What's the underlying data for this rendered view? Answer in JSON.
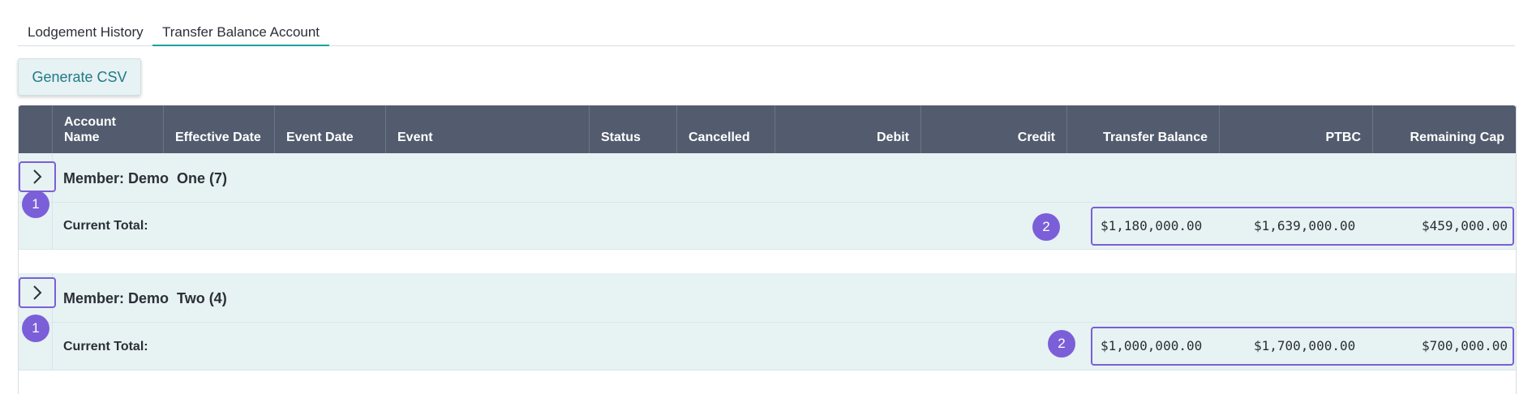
{
  "tabs": [
    {
      "label": "Lodgement History",
      "active": false
    },
    {
      "label": "Transfer Balance Account",
      "active": true
    }
  ],
  "actions": {
    "generate_csv_label": "Generate CSV"
  },
  "table": {
    "columns": [
      {
        "label": "",
        "align": "left"
      },
      {
        "label": "Account\nName",
        "align": "left"
      },
      {
        "label": "Effective Date",
        "align": "left"
      },
      {
        "label": "Event Date",
        "align": "left"
      },
      {
        "label": "Event",
        "align": "left"
      },
      {
        "label": "Status",
        "align": "left"
      },
      {
        "label": "Cancelled",
        "align": "left"
      },
      {
        "label": "Debit",
        "align": "right"
      },
      {
        "label": "Credit",
        "align": "right"
      },
      {
        "label": "Transfer Balance",
        "align": "right"
      },
      {
        "label": "PTBC",
        "align": "right"
      },
      {
        "label": "Remaining Cap",
        "align": "right"
      }
    ],
    "groups": [
      {
        "member_label": "Member: Demo",
        "member_name": "One (7)",
        "expand_badge": "1",
        "total_label": "Current Total:",
        "total_badge": "2",
        "transfer_balance": "$1,180,000.00",
        "ptbc": "$1,639,000.00",
        "remaining_cap": "$459,000.00"
      },
      {
        "member_label": "Member: Demo",
        "member_name": "Two (4)",
        "expand_badge": "1",
        "total_label": "Current Total:",
        "total_badge": "2",
        "transfer_balance": "$1,000,000.00",
        "ptbc": "$1,700,000.00",
        "remaining_cap": "$700,000.00"
      }
    ]
  },
  "icons": {
    "expand": "chevron-right-icon"
  },
  "colors": {
    "header_bg": "#525c6e",
    "row_bg": "#e7f2f3",
    "highlight": "#7a5fd6",
    "active_tab": "#17a2a0",
    "button_text": "#227a86"
  }
}
